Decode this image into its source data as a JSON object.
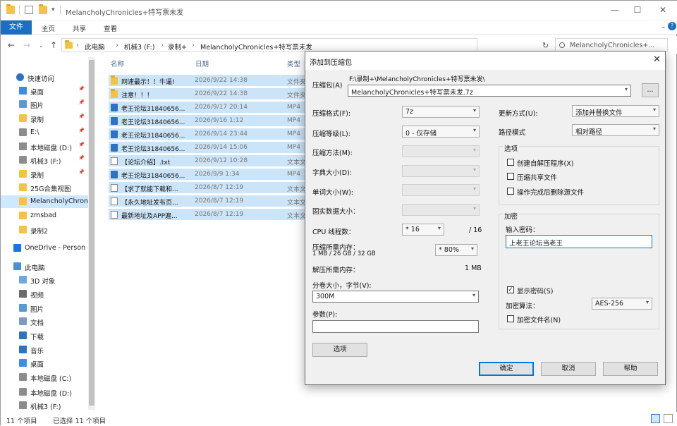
{
  "window": {
    "title": "MelancholyChronicles+特写票未发",
    "min": "—",
    "max": "☐",
    "close": "✕"
  },
  "ribbon": {
    "file": "文件",
    "home": "主页",
    "share": "共享",
    "view": "查看"
  },
  "address": {
    "crumbs": [
      "此电脑",
      "机械3 (F:)",
      "录制+",
      "MelancholyChronicles+特写票未发"
    ],
    "search_placeholder": "MelancholyChronicles+..."
  },
  "nav": {
    "items": [
      {
        "label": "快速访问",
        "icon": "star-icon",
        "pinned": false
      },
      {
        "label": "桌面",
        "icon": "desktop-icon",
        "pinned": true
      },
      {
        "label": "图片",
        "icon": "pictures-icon",
        "pinned": true
      },
      {
        "label": "录制",
        "icon": "folder-icon",
        "pinned": true
      },
      {
        "label": "E:\\",
        "icon": "drive-icon",
        "pinned": true
      },
      {
        "label": "本地磁盘 (D:)",
        "icon": "drive-icon",
        "pinned": true
      },
      {
        "label": "机械3 (F:)",
        "icon": "drive-icon",
        "pinned": true
      },
      {
        "label": "录制",
        "icon": "folder-icon",
        "pinned": true
      },
      {
        "label": "25G合集视图",
        "icon": "folder-icon",
        "pinned": false
      },
      {
        "label": "MelancholyChronic",
        "icon": "folder-icon",
        "pinned": false
      },
      {
        "label": "zmsbad",
        "icon": "folder-icon",
        "pinned": false
      },
      {
        "label": "录制2",
        "icon": "folder-icon",
        "pinned": false
      },
      {
        "label": "OneDrive - Person",
        "icon": "cloud-icon",
        "pinned": false
      },
      {
        "label": "此电脑",
        "icon": "pc-icon",
        "pinned": false
      },
      {
        "label": "3D 对象",
        "icon": "cube-icon",
        "pinned": false
      },
      {
        "label": "视频",
        "icon": "video-icon",
        "pinned": false
      },
      {
        "label": "图片",
        "icon": "pictures-icon",
        "pinned": false
      },
      {
        "label": "文档",
        "icon": "document-icon",
        "pinned": false
      },
      {
        "label": "下载",
        "icon": "download-icon",
        "pinned": false
      },
      {
        "label": "音乐",
        "icon": "music-icon",
        "pinned": false
      },
      {
        "label": "桌面",
        "icon": "desktop-icon",
        "pinned": false
      },
      {
        "label": "本地磁盘 (C:)",
        "icon": "drive-icon",
        "pinned": false
      },
      {
        "label": "本地磁盘 (D:)",
        "icon": "drive-icon",
        "pinned": false
      },
      {
        "label": "机械3 (F:)",
        "icon": "drive-icon",
        "pinned": false
      }
    ]
  },
  "filelist": {
    "headers": {
      "name": "名称",
      "date": "日期",
      "type": "类型"
    },
    "rows": [
      {
        "name": "网速最示！！牛逼!",
        "date": "2026/9/22 14:38",
        "type": "文件夹",
        "kind": "folder"
      },
      {
        "name": "注意！！！",
        "date": "2026/9/22 14:38",
        "type": "文件夹",
        "kind": "folder"
      },
      {
        "name": "老王论坛31840656...",
        "date": "2026/9/17 20:14",
        "type": "MP4",
        "kind": "mp4"
      },
      {
        "name": "老王论坛31840656...",
        "date": "2026/9/16 1:12",
        "type": "MP4",
        "kind": "mp4"
      },
      {
        "name": "老王论坛31840656...",
        "date": "2026/9/14 23:44",
        "type": "MP4",
        "kind": "mp4"
      },
      {
        "name": "老王论坛31840656...",
        "date": "2026/9/14 15:06",
        "type": "MP4",
        "kind": "mp4"
      },
      {
        "name": "【论坛介绍】.txt",
        "date": "2026/9/12 10:28",
        "type": "文本文",
        "kind": "txt"
      },
      {
        "name": "老王论坛31840656...",
        "date": "2026/9/9 1:34",
        "type": "MP4",
        "kind": "mp4"
      },
      {
        "name": "【求了就能下载和...",
        "date": "2026/8/7 12:19",
        "type": "文本文",
        "kind": "txt"
      },
      {
        "name": "【永久地址发布页...",
        "date": "2026/8/7 12:19",
        "type": "文本文",
        "kind": "txt"
      },
      {
        "name": "最新地址及APP遍...",
        "date": "2026/8/7 12:19",
        "type": "文本文",
        "kind": "txt"
      }
    ]
  },
  "status": {
    "count": "11 个项目",
    "selected": "已选择 11 个项目"
  },
  "dialog": {
    "title": "添加到压缩包",
    "archive_label": "压缩包(A)",
    "archive_path": "F:\\录制+\\MelancholyChronicles+特写票未发\\",
    "archive_name": "MelancholyChronicles+特写票未发.7z",
    "browse": "...",
    "format_label": "压缩格式(F):",
    "format_value": "7z",
    "level_label": "压缩等级(L):",
    "level_value": "0 - 仅存储",
    "method_label": "压缩方法(M):",
    "dict_label": "字典大小(D):",
    "word_label": "单词大小(W):",
    "solid_label": "固实数据大小：",
    "threads_label": "CPU 线程数：",
    "threads_value": "* 16",
    "threads_max": "/ 16",
    "mem_label": "压缩所需内存：",
    "mem_detail": "1 MB / 26 GB / 32 GB",
    "mem_value": "* 80%",
    "decomp_label": "解压所需内存：",
    "decomp_value": "1 MB",
    "split_label": "分卷大小，字节(V):",
    "split_value": "300M",
    "params_label": "参数(P):",
    "options_button": "选项",
    "update_label": "更新方式(U):",
    "update_value": "添加并替换文件",
    "path_label": "路径模式",
    "path_value": "相对路径",
    "options_group": "选项",
    "opt_sfx": "创建自解压程序(X)",
    "opt_shared": "压缩共享文件",
    "opt_delete": "操作完成后删除源文件",
    "encrypt_group": "加密",
    "password_label": "输入密码：",
    "password_value": "上老王论坛当老王",
    "show_password": "显示密码(S)",
    "encrypt_method_label": "加密算法：",
    "encrypt_method_value": "AES-256",
    "encrypt_names": "加密文件名(N)",
    "ok": "确定",
    "cancel": "取消",
    "help": "帮助"
  }
}
